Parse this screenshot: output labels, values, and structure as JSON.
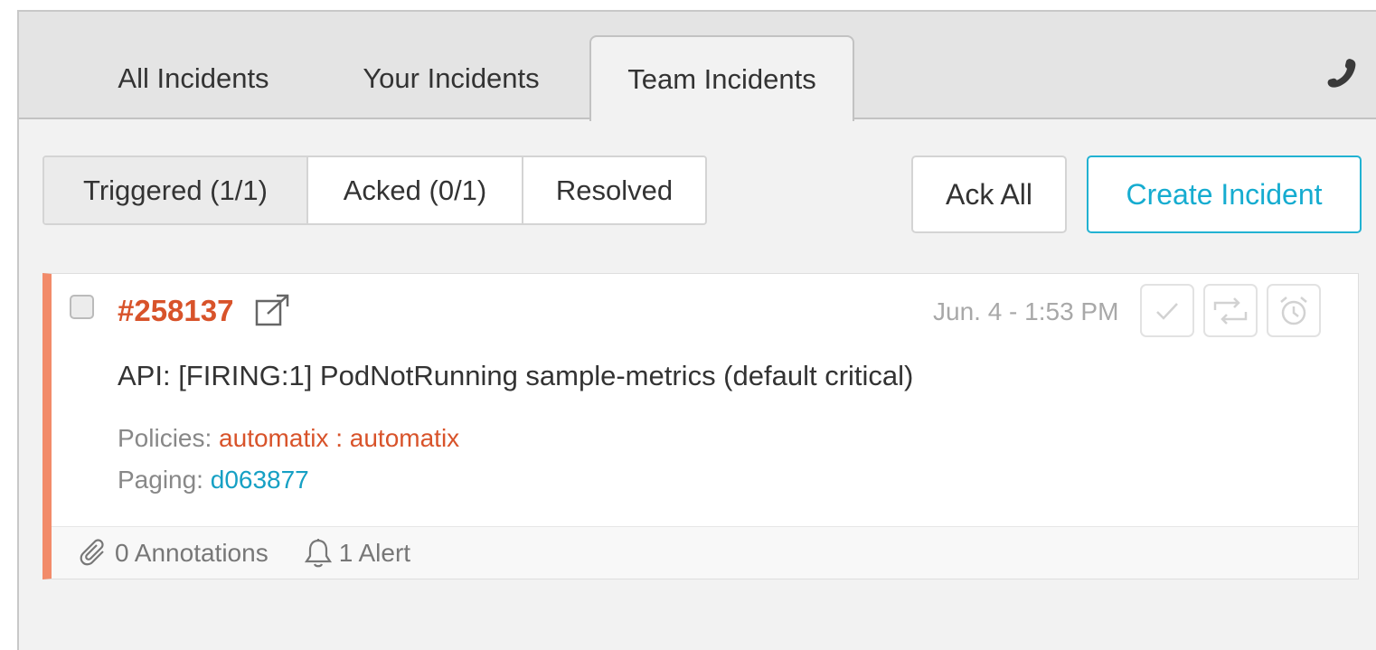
{
  "tabs": {
    "all": "All Incidents",
    "your": "Your Incidents",
    "team": "Team Incidents",
    "active": "Team Incidents"
  },
  "header": {
    "phone_icon": "phone-icon"
  },
  "filters": {
    "triggered": "Triggered (1/1)",
    "acked": "Acked (0/1)",
    "resolved": "Resolved",
    "active": "Triggered (1/1)"
  },
  "actions": {
    "ack_all": "Ack All",
    "create_incident": "Create Incident"
  },
  "incident": {
    "id": "#258137",
    "timestamp": "Jun. 4 - 1:53 PM",
    "title": "API: [FIRING:1] PodNotRunning sample-metrics (default critical)",
    "policies_label": "Policies:",
    "policies_value": "automatix : automatix",
    "paging_label": "Paging:",
    "paging_value": "d063877",
    "annotations": "0 Annotations",
    "alerts": "1 Alert",
    "severity_color": "#f28b6a",
    "action_icons": [
      "check-icon",
      "escalate-icon",
      "snooze-icon"
    ]
  },
  "colors": {
    "accent": "#16acd0",
    "incident_red": "#d8532a",
    "link_blue": "#16a0c4"
  }
}
